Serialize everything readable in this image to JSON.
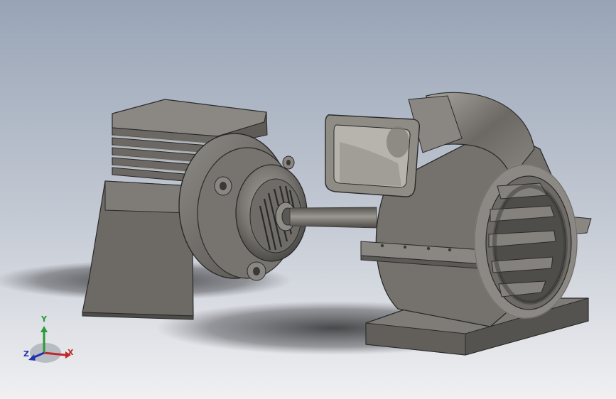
{
  "viewport": {
    "background_top": "#98a4b6",
    "background_bottom": "#f0f0f2"
  },
  "triad": {
    "x_label": "X",
    "y_label": "Y",
    "z_label": "Z",
    "x_color": "#c0282c",
    "y_color": "#2a9a3a",
    "z_color": "#2233b0"
  },
  "model": {
    "parts": [
      "motor-housing",
      "motor-endcap",
      "motor-shaft",
      "blower-housing",
      "blower-outlet-duct",
      "blower-base"
    ],
    "color": "#77746f"
  }
}
